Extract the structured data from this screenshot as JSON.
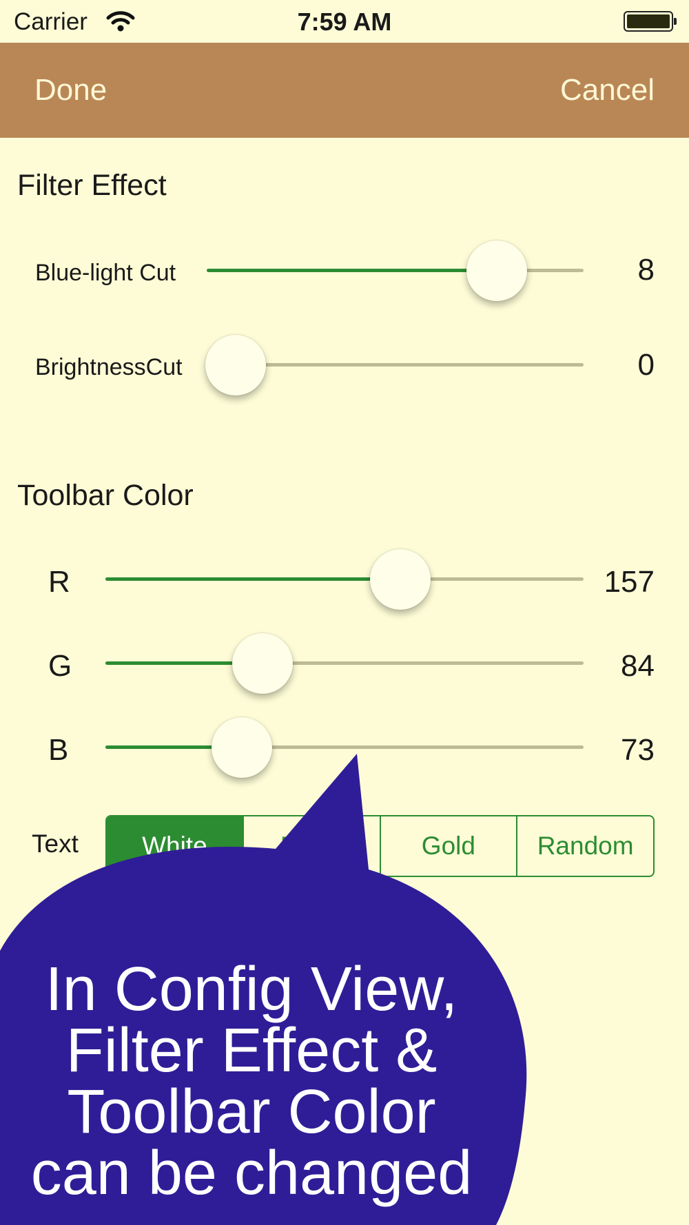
{
  "status_bar": {
    "carrier": "Carrier",
    "time": "7:59 AM",
    "wifi_icon": "wifi-icon",
    "battery_icon": "battery-icon"
  },
  "nav": {
    "done_label": "Done",
    "cancel_label": "Cancel",
    "background": "#b98756"
  },
  "filter_effect": {
    "title": "Filter Effect",
    "blue_light": {
      "label": "Blue-light Cut",
      "value": "8",
      "fraction": 0.77
    },
    "brightness": {
      "label": "BrightnessCut",
      "value": "0",
      "fraction": 0.0
    }
  },
  "toolbar_color": {
    "title": "Toolbar Color",
    "r": {
      "label": "R",
      "value": "157",
      "fraction": 0.616
    },
    "g": {
      "label": "G",
      "value": "84",
      "fraction": 0.329
    },
    "b": {
      "label": "B",
      "value": "73",
      "fraction": 0.286
    }
  },
  "text_color": {
    "label": "Text",
    "options": [
      "White",
      "Black",
      "Gold",
      "Random"
    ],
    "selected": "White"
  },
  "callout": {
    "lines": [
      "In Config View,",
      "Filter Effect &",
      "Toolbar Color",
      "can be changed"
    ],
    "color": "#2f1d97"
  },
  "colors": {
    "background": "#fdfcd6",
    "accent": "#2c8c32",
    "track": "#bdbb95"
  }
}
